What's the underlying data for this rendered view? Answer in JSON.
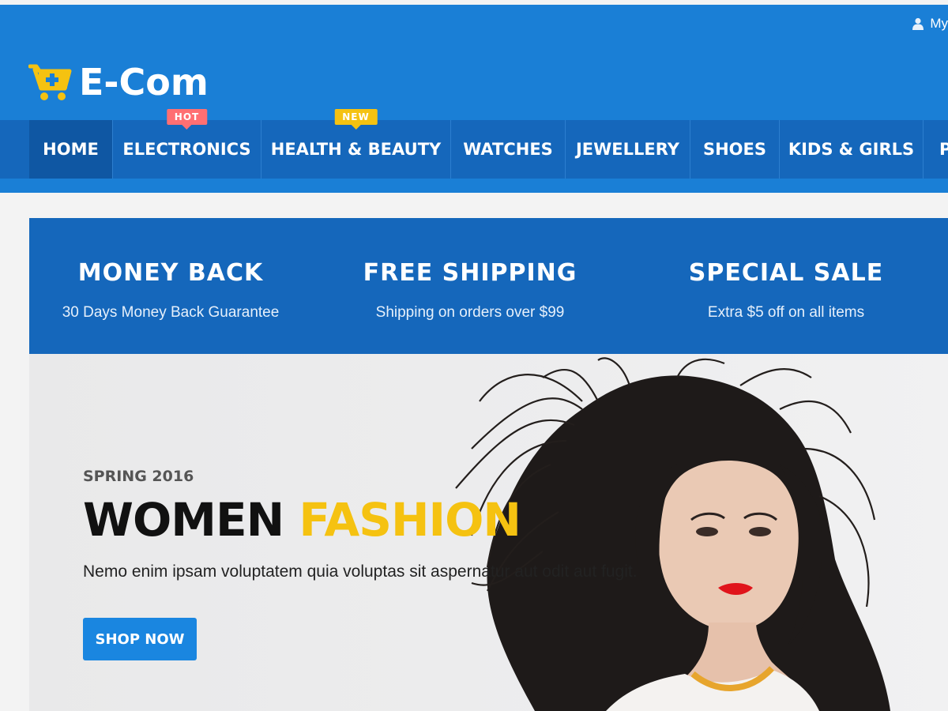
{
  "header": {
    "account_label": "My",
    "logo_text": "E-Com",
    "colors": {
      "header_bg": "#1a7fd6",
      "nav_bg": "#1567bb",
      "accent_yellow": "#f5c211",
      "hot_badge": "#ff6f72"
    }
  },
  "nav": {
    "items": [
      {
        "label": "HOME",
        "active": true
      },
      {
        "label": "ELECTRONICS",
        "badge": "HOT"
      },
      {
        "label": "HEALTH & BEAUTY",
        "badge": "NEW"
      },
      {
        "label": "WATCHES"
      },
      {
        "label": "JEWELLERY"
      },
      {
        "label": "SHOES"
      },
      {
        "label": "KIDS & GIRLS"
      },
      {
        "label": "P"
      }
    ]
  },
  "features": [
    {
      "title": "MONEY BACK",
      "subtitle": "30 Days Money Back Guarantee"
    },
    {
      "title": "FREE SHIPPING",
      "subtitle": "Shipping on orders over $99"
    },
    {
      "title": "SPECIAL SALE",
      "subtitle": "Extra $5 off on all items"
    }
  ],
  "hero": {
    "season": "SPRING 2016",
    "title_part1": "WOMEN",
    "title_part2": "FASHION",
    "description": "Nemo enim ipsam voluptatem quia voluptas sit aspernatur aut odit aut fugit.",
    "cta_label": "SHOP NOW"
  },
  "icons": [
    "user-icon",
    "cart-logo-icon"
  ]
}
